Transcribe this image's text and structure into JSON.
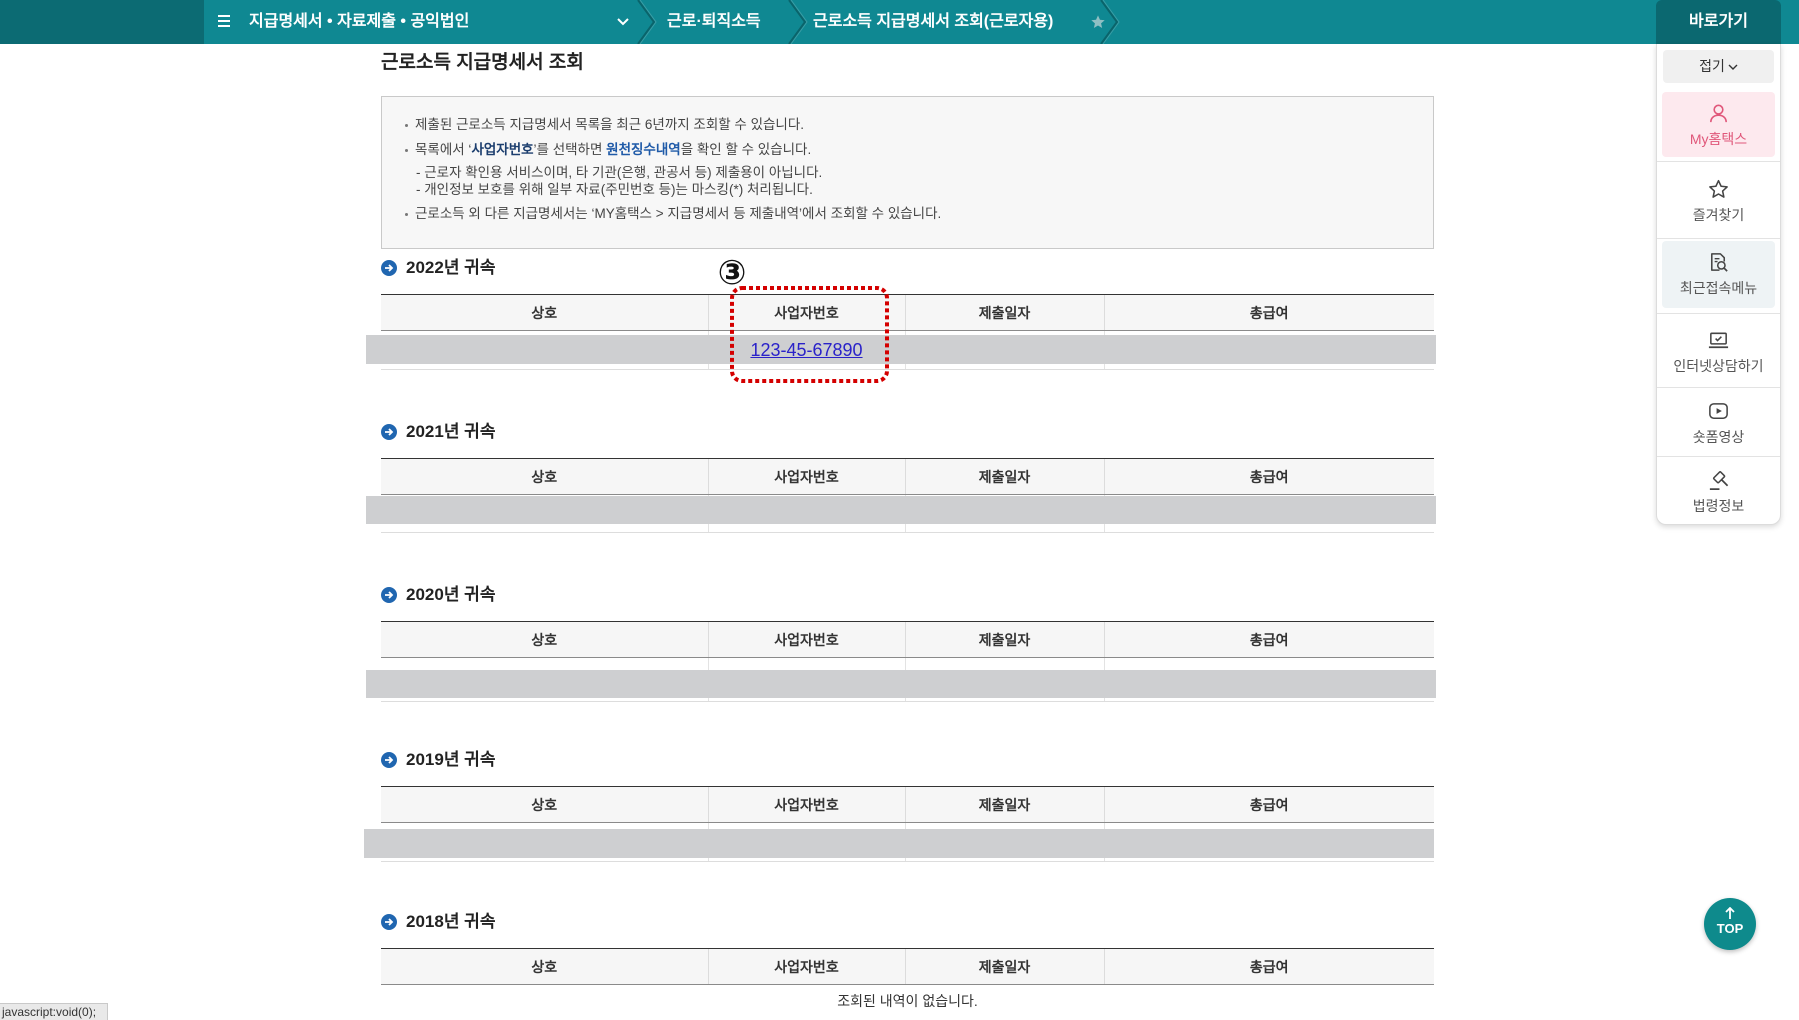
{
  "topnav": {
    "category": "지급명세서 • 자료제출 • 공익법인",
    "crumb_1": "근로·퇴직소득",
    "crumb_2": "근로소득 지급명세서 조회(근로자용)",
    "icons": {
      "menu": "hamburger-icon",
      "dropdown": "chevron-down-icon",
      "favorite": "star-icon"
    }
  },
  "page_title": "근로소득 지급명세서 조회",
  "notice": {
    "line_1": "제출된 근로소득 지급명세서 목록을 최근 6년까지 조회할 수 있습니다.",
    "line_2": {
      "pre": "목록에서 ‘",
      "term_1": "사업자번호",
      "mid": "’를 선택하면 ",
      "term_2": "원천징수내역",
      "post": "을 확인 할 수 있습니다."
    },
    "line_3": "- 근로자 확인용 서비스이며, 타 기관(은행, 관공서 등) 제출용이 아닙니다.",
    "line_4": "- 개인정보 보호를 위해 일부 자료(주민번호 등)는 마스킹(*) 처리됩니다.",
    "line_5": "근로소득 외 다른 지급명세서는 ‘MY홈택스 > 지급명세서 등 제출내역’에서 조회할 수 있습니다."
  },
  "table_columns": [
    "상호",
    "사업자번호",
    "제출일자",
    "총급여"
  ],
  "sections": [
    {
      "year": "2022년 귀속",
      "business_number": "123-45-67890"
    },
    {
      "year": "2021년 귀속"
    },
    {
      "year": "2020년 귀속"
    },
    {
      "year": "2019년 귀속"
    },
    {
      "year": "2018년 귀속",
      "empty_message": "조회된 내역이 없습니다."
    }
  ],
  "annotation": {
    "marker": "③"
  },
  "quick_menu": {
    "title": "바로가기",
    "collapse": "접기",
    "items": [
      {
        "label": "My홈택스",
        "icon": "person-icon"
      },
      {
        "label": "즐겨찾기",
        "icon": "star-icon"
      },
      {
        "label": "최근접속메뉴",
        "icon": "recent-menu-icon"
      },
      {
        "label": "인터넷상담하기",
        "icon": "laptop-check-icon"
      },
      {
        "label": "숏폼영상",
        "icon": "play-icon"
      },
      {
        "label": "법령정보",
        "icon": "gavel-icon"
      }
    ]
  },
  "top_button": "TOP",
  "status_bar": "javascript:void(0);",
  "colors": {
    "nav": "#0f8892",
    "nav_dark": "#0c6b73",
    "quick_header": "#0b6870",
    "top_button": "#0e8a8c",
    "term_dark": "#1c3e6e",
    "term_blue": "#1f5aa8",
    "redaction": "#cecfd1",
    "highlight_box": "#d40000",
    "my_hometax": "#e0577a"
  }
}
